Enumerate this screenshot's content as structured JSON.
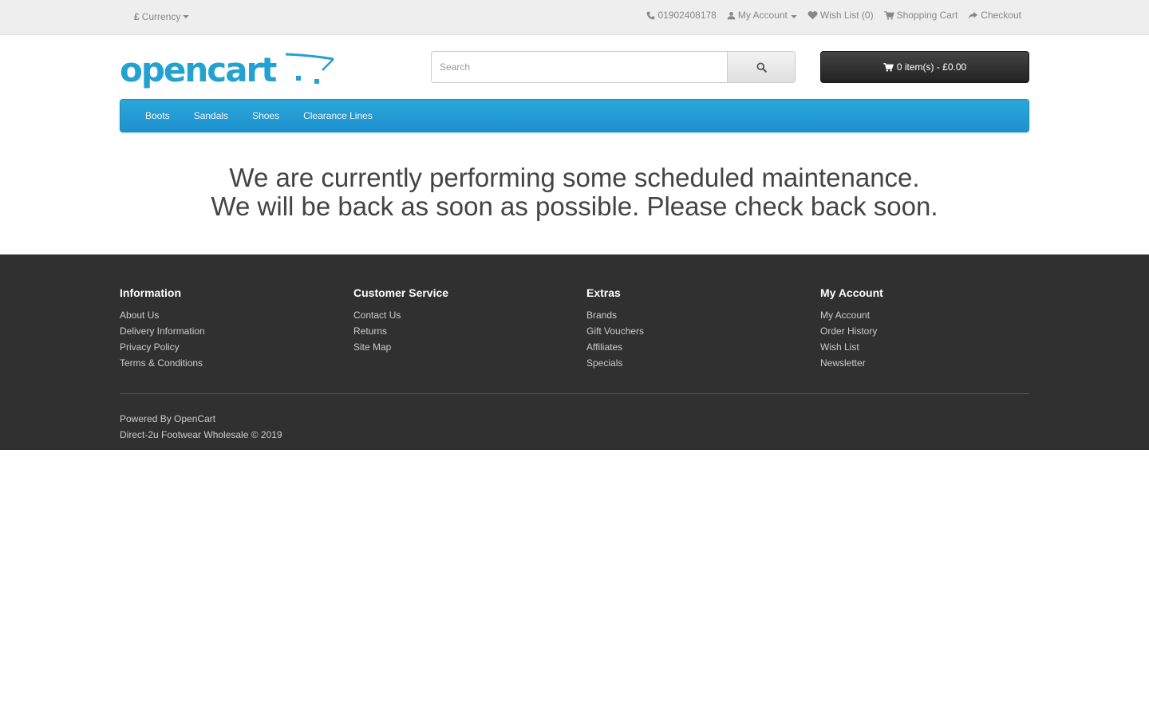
{
  "topbar": {
    "currency_symbol": "£",
    "currency_label": "Currency",
    "phone": "01902408178",
    "my_account": "My Account",
    "wish_list": "Wish List (0)",
    "shopping_cart": "Shopping Cart",
    "checkout": "Checkout"
  },
  "header": {
    "logo_text": "opencart",
    "search_placeholder": "Search",
    "cart_label": "0 item(s) - £0.00"
  },
  "menu": {
    "items": [
      "Boots",
      "Sandals",
      "Shoes",
      "Clearance Lines"
    ]
  },
  "main": {
    "line1": "We are currently performing some scheduled maintenance.",
    "line2": "We will be back as soon as possible. Please check back soon."
  },
  "footer": {
    "columns": [
      {
        "title": "Information",
        "links": [
          "About Us",
          "Delivery Information",
          "Privacy Policy",
          "Terms & Conditions"
        ]
      },
      {
        "title": "Customer Service",
        "links": [
          "Contact Us",
          "Returns",
          "Site Map"
        ]
      },
      {
        "title": "Extras",
        "links": [
          "Brands",
          "Gift Vouchers",
          "Affiliates",
          "Specials"
        ]
      },
      {
        "title": "My Account",
        "links": [
          "My Account",
          "Order History",
          "Wish List",
          "Newsletter"
        ]
      }
    ],
    "powered_prefix": "Powered By ",
    "powered_link": "OpenCart",
    "copyright": "Direct-2u Footwear Wholesale © 2019"
  },
  "colors": {
    "brand_blue": "#23a1d1",
    "menu_blue": "#229ac8",
    "footer_bg": "#303030",
    "topbar_bg": "#eeeeee"
  }
}
